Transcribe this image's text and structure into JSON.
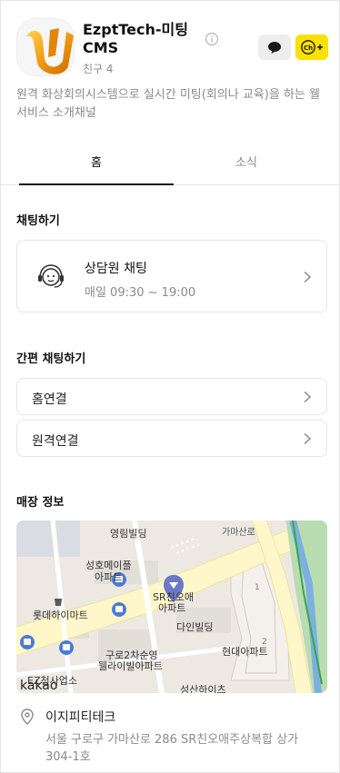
{
  "channel": {
    "name": "EzptTech-미팅 CMS",
    "friends": "친구 4",
    "description": "원격 화상회의시스템으로 실시간 미팅(회의나 교육)을 하는 웰서비스 소개채널",
    "chat_button_icon": "speech-bubble-icon",
    "ch_plus_label": "Ch+",
    "accent_color": "#fae100"
  },
  "tabs": [
    {
      "label": "홈",
      "active": true
    },
    {
      "label": "소식",
      "active": false
    }
  ],
  "chat_section": {
    "title": "채팅하기",
    "counsel_name": "상담원 채팅",
    "counsel_hours": "매일 09:30 ~ 19:00"
  },
  "quick_chat": {
    "title": "간편 채팅하기",
    "items": [
      {
        "label": "홈연결"
      },
      {
        "label": "원격연결"
      }
    ]
  },
  "store": {
    "title": "매장 정보",
    "map_labels": [
      "영림빌딩",
      "가마산로",
      "성호메이플 아파트",
      "SR친오애 아파트",
      "롯데하이마트",
      "다인빌딩",
      "구로2차순영 웰라이빌아파트",
      "현대아파트",
      "EZ천사업소",
      "성산하이츠"
    ],
    "map_logo": "kakao",
    "place_name": "이지피티테크",
    "address": "서울 구로구 가마산로 286 SR친오애주상복합 상가 304-1호"
  }
}
